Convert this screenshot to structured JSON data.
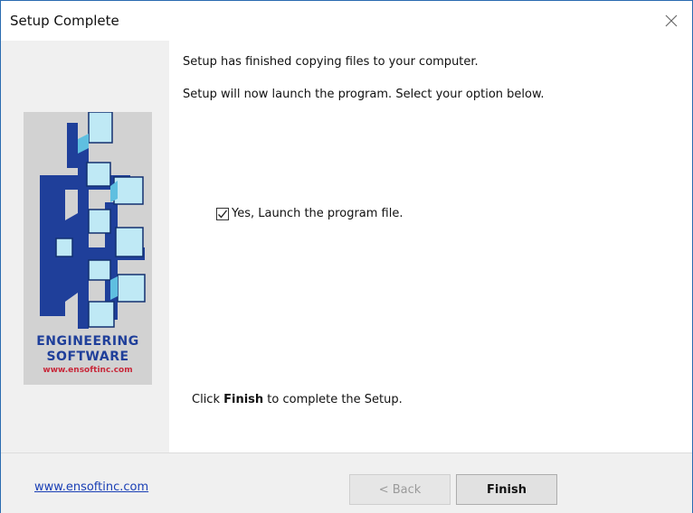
{
  "window": {
    "title": "Setup Complete"
  },
  "logo": {
    "line1": "ENGINEERING",
    "line2": "SOFTWARE",
    "url": "www.ensoftinc.com"
  },
  "messages": {
    "copied": "Setup has finished copying files to your computer.",
    "launch_info": "Setup will now launch the program. Select your option below.",
    "finish_prefix": "Click ",
    "finish_bold": "Finish",
    "finish_suffix": " to complete the Setup."
  },
  "launch_option": {
    "label": "Yes, Launch the program file.",
    "checked": true
  },
  "footer": {
    "link": "www.ensoftinc.com",
    "back_label": "< Back",
    "finish_label": "Finish"
  },
  "colors": {
    "window_border": "#2a6bb0",
    "logo_blue": "#1f3f9a",
    "logo_cyan": "#bfe9f5",
    "logo_url_red": "#c8283a",
    "link_blue": "#1a3fb5"
  }
}
